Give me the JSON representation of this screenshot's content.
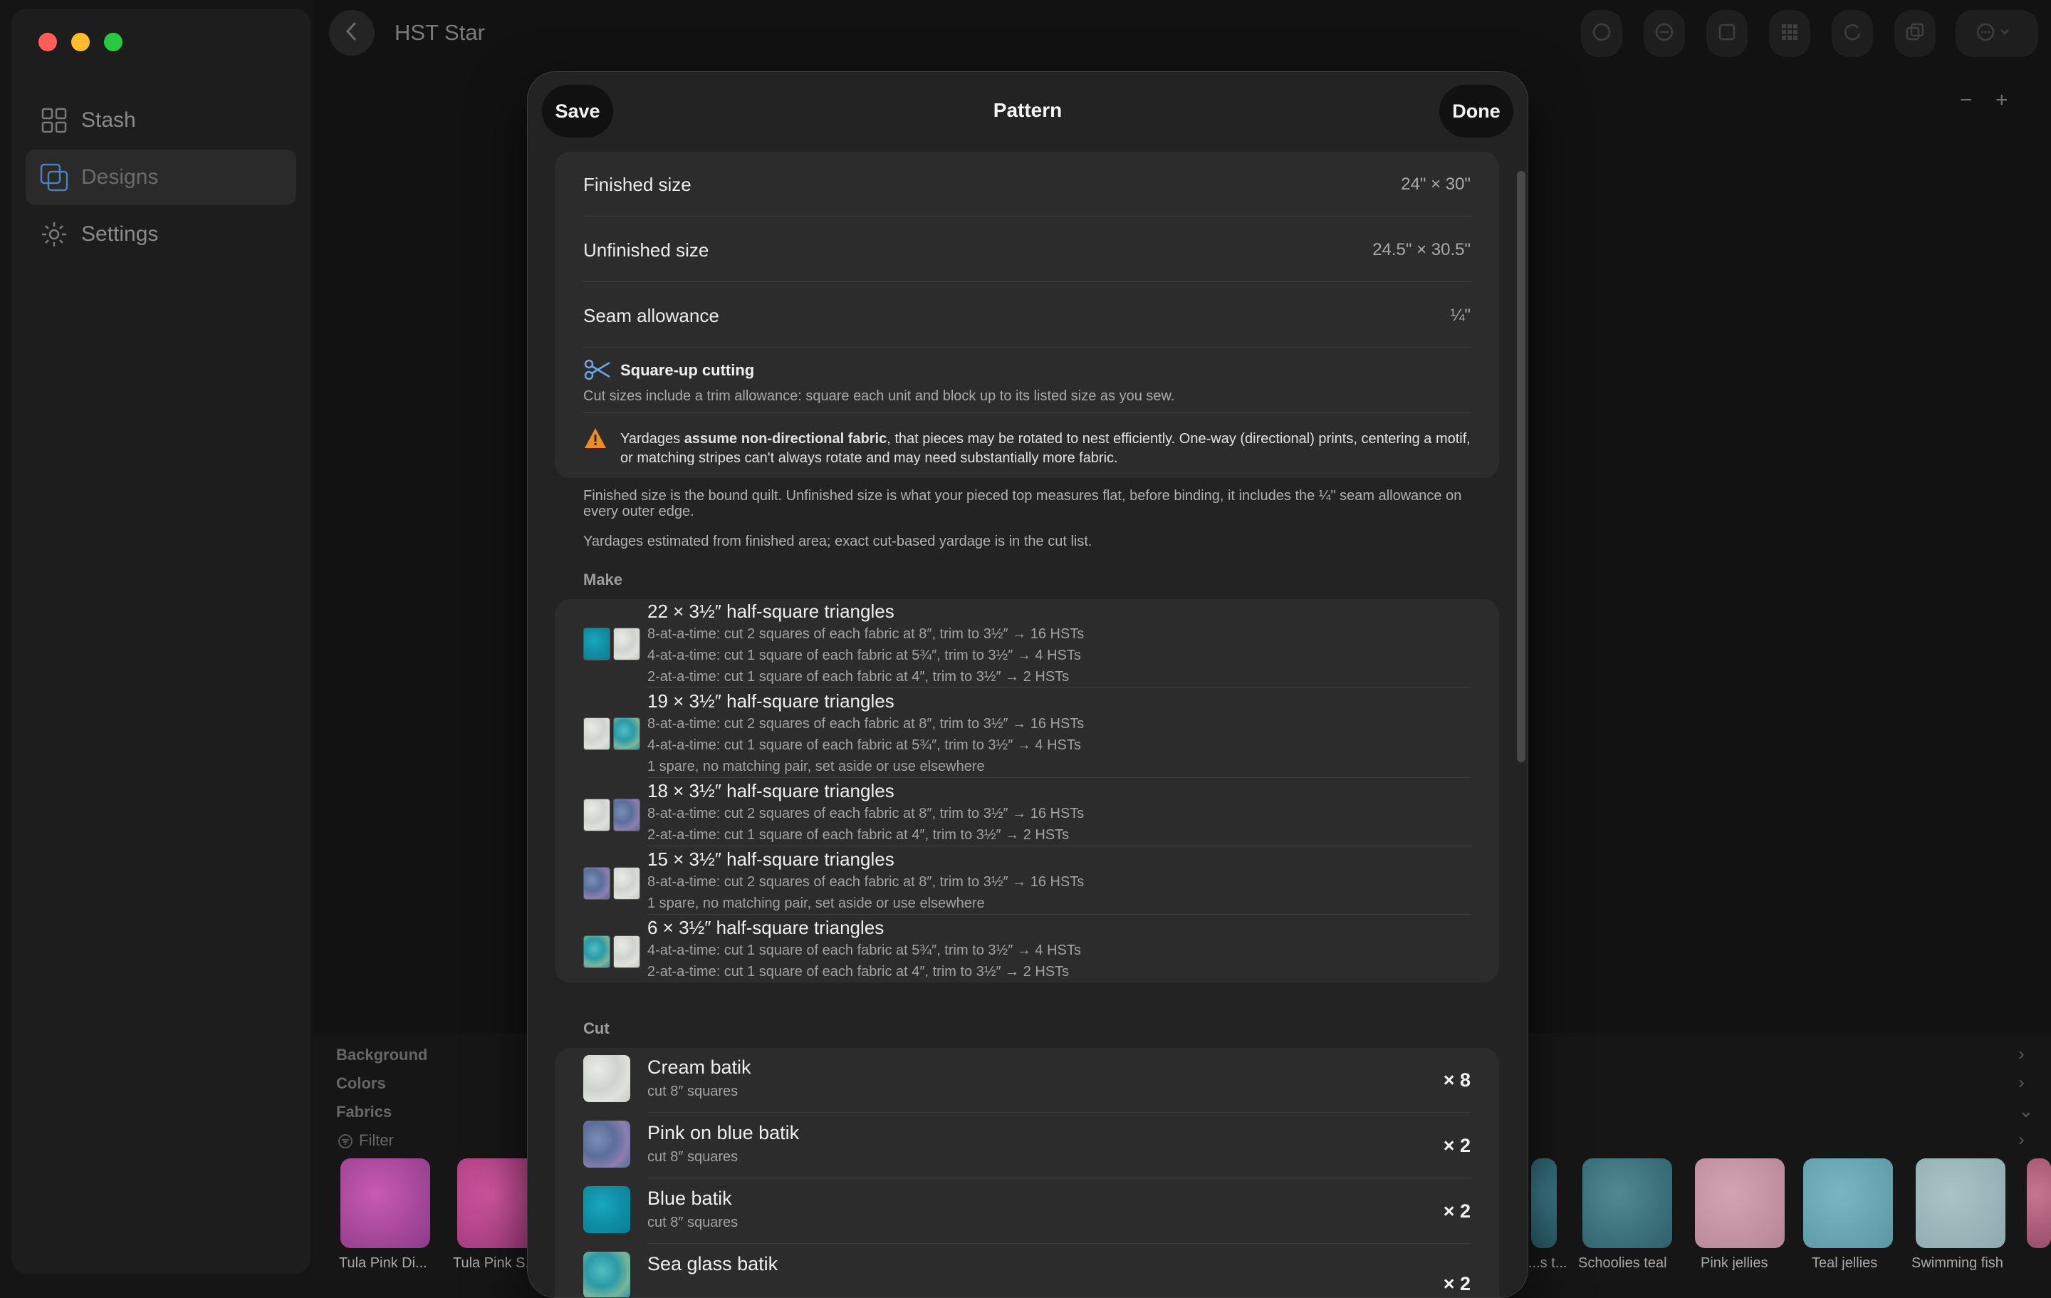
{
  "window": {
    "title": "HST Star"
  },
  "sidebar": {
    "items": [
      {
        "label": "Stash",
        "icon": "grid-icon"
      },
      {
        "label": "Designs",
        "icon": "designs-icon",
        "active": true
      },
      {
        "label": "Settings",
        "icon": "gear-icon"
      }
    ]
  },
  "zoom": {
    "minus": "−",
    "plus": "+"
  },
  "bottom_panel": {
    "sections": [
      "Background",
      "Colors",
      "Fabrics"
    ],
    "filter_label": "Filter",
    "swatches": [
      {
        "label": "Tula Pink Di..."
      },
      {
        "label": "Tula Pink S..."
      },
      {
        "label": "...s t..."
      },
      {
        "label": "Schoolies teal"
      },
      {
        "label": "Pink jellies"
      },
      {
        "label": "Teal jellies"
      },
      {
        "label": "Swimming fish"
      }
    ]
  },
  "sheet": {
    "title": "Pattern",
    "save_label": "Save",
    "done_label": "Done",
    "sizes": [
      {
        "label": "Finished size",
        "value": "24\" × 30\""
      },
      {
        "label": "Unfinished size",
        "value": "24.5\" × 30.5\""
      },
      {
        "label": "Seam allowance",
        "value": "¼\""
      }
    ],
    "square_up": {
      "title": "Square-up cutting",
      "text": "Cut sizes include a trim allowance: square each unit and block up to its listed size as you sew."
    },
    "warning": {
      "prefix": "Yardages ",
      "bold": "assume non-directional fabric",
      "rest": ", that pieces may be rotated to nest efficiently. One-way (directional) prints, centering a motif, or matching stripes can't always rotate and may need substantially more fabric."
    },
    "notes": [
      "Finished size is the bound quilt. Unfinished size is what your pieced top measures flat, before binding, it includes the ¼\" seam allowance on every outer edge.",
      "Yardages estimated from finished area; exact cut-based yardage is in the cut list."
    ],
    "make_header": "Make",
    "make": [
      {
        "title": "22 × 3½″ half-square triangles",
        "lines": [
          "8-at-a-time: cut 2 squares of each fabric at 8″, trim to 3½″ → 16 HSTs",
          "4-at-a-time: cut 1 square of each fabric at 5¾″, trim to 3½″ → 4 HSTs",
          "2-at-a-time: cut 1 square of each fabric at 4″, trim to 3½″ → 2 HSTs"
        ]
      },
      {
        "title": "19 × 3½″ half-square triangles",
        "lines": [
          "8-at-a-time: cut 2 squares of each fabric at 8″, trim to 3½″ → 16 HSTs",
          "4-at-a-time: cut 1 square of each fabric at 5¾″, trim to 3½″ → 4 HSTs",
          "1 spare, no matching pair, set aside or use elsewhere"
        ]
      },
      {
        "title": "18 × 3½″ half-square triangles",
        "lines": [
          "8-at-a-time: cut 2 squares of each fabric at 8″, trim to 3½″ → 16 HSTs",
          "2-at-a-time: cut 1 square of each fabric at 4″, trim to 3½″ → 2 HSTs"
        ]
      },
      {
        "title": "15 × 3½″ half-square triangles",
        "lines": [
          "8-at-a-time: cut 2 squares of each fabric at 8″, trim to 3½″ → 16 HSTs",
          "1 spare, no matching pair, set aside or use elsewhere"
        ]
      },
      {
        "title": "6 × 3½″ half-square triangles",
        "lines": [
          "4-at-a-time: cut 1 square of each fabric at 5¾″, trim to 3½″ → 4 HSTs",
          "2-at-a-time: cut 1 square of each fabric at 4″, trim to 3½″ → 2 HSTs"
        ]
      }
    ],
    "cut_header": "Cut",
    "cut": [
      {
        "name": "Cream batik",
        "sub": "cut 8″ squares",
        "qty": "× 8"
      },
      {
        "name": "Pink on blue batik",
        "sub": "cut 8″ squares",
        "qty": "× 2"
      },
      {
        "name": "Blue batik",
        "sub": "cut 8″ squares",
        "qty": "× 2"
      },
      {
        "name": "Sea glass batik",
        "sub": "",
        "qty": "× 2"
      }
    ]
  }
}
